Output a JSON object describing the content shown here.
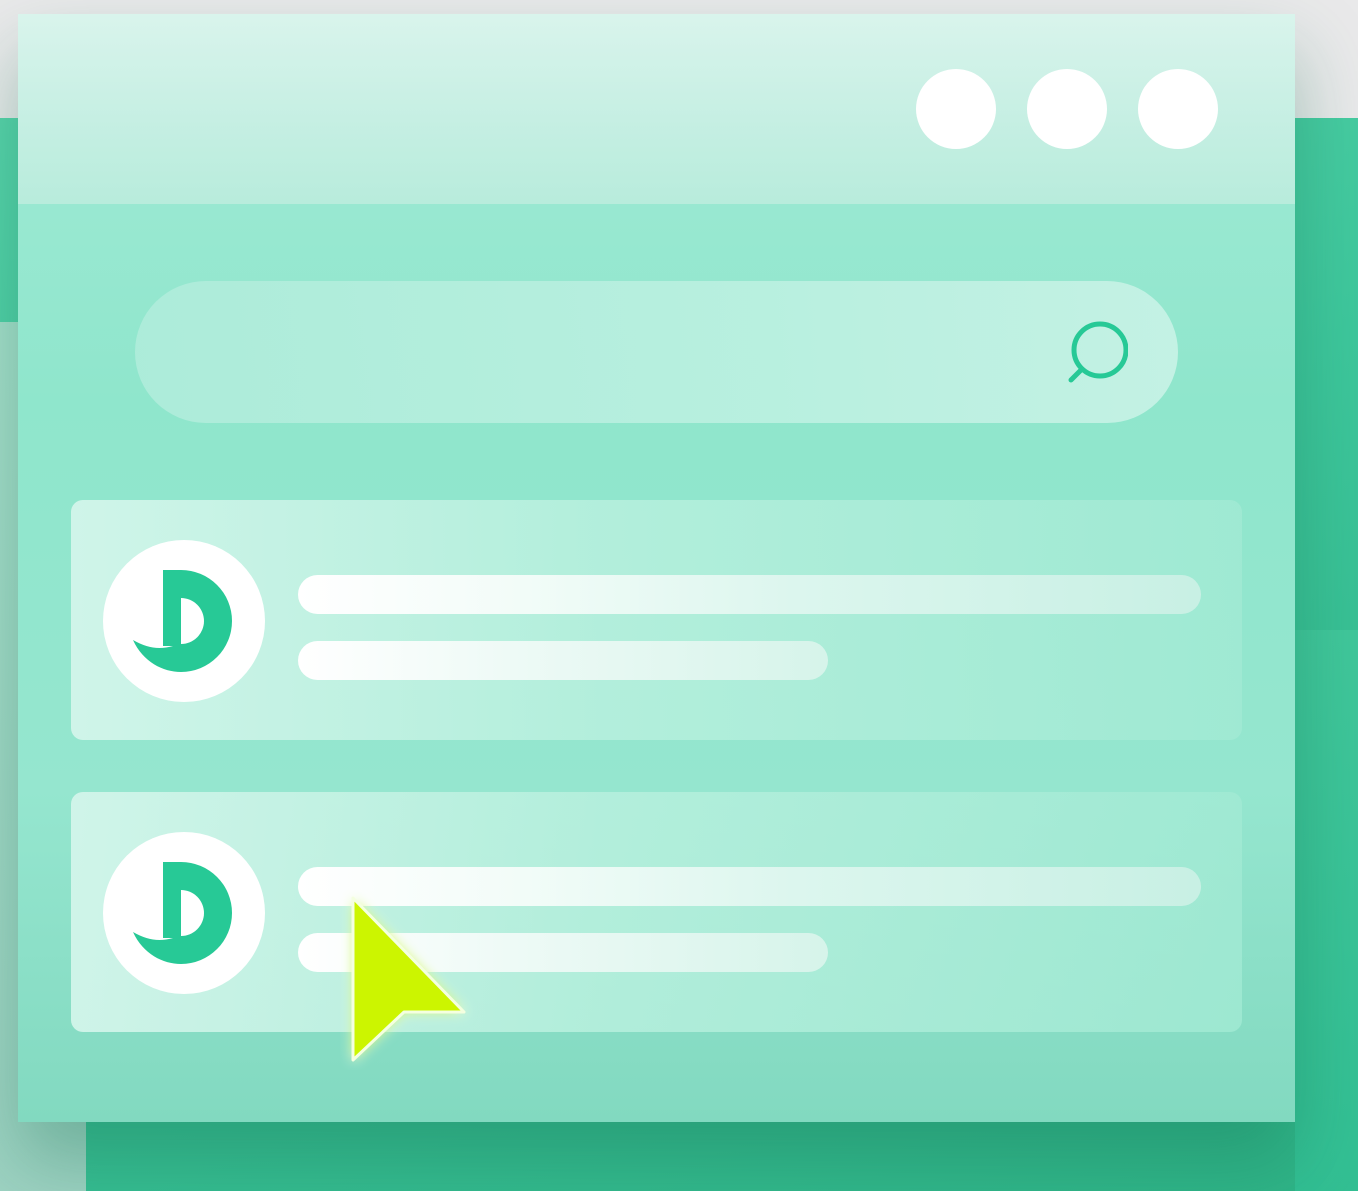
{
  "window": {
    "controls": [
      "window-dot-1",
      "window-dot-2",
      "window-dot-3"
    ]
  },
  "search": {
    "icon": "search-icon"
  },
  "results": [
    {
      "icon": "brand-logo-icon"
    },
    {
      "icon": "brand-logo-icon"
    }
  ],
  "cursor": {
    "icon": "cursor-arrow-icon"
  },
  "colors": {
    "accent": "#27c996",
    "cursor": "#ccf500",
    "window_body": "#92e6ce",
    "titlebar": "#cdf1e6",
    "background_green": "#3ec79c"
  }
}
